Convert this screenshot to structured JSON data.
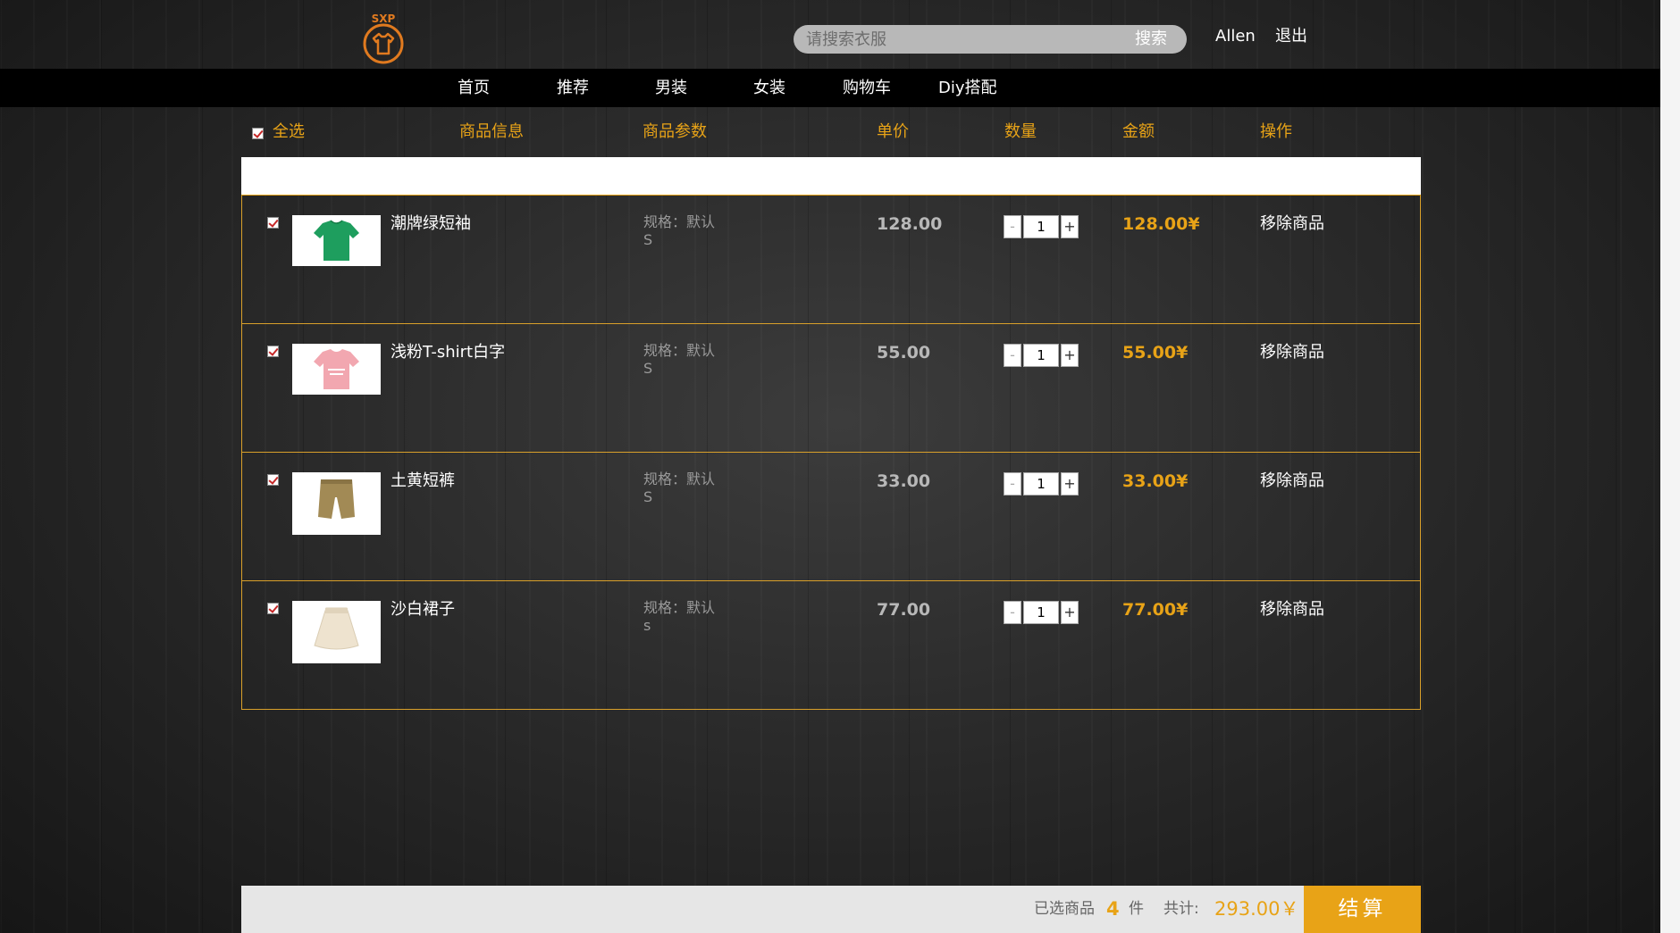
{
  "colors": {
    "accent": "#e8a317",
    "navbar": "#000000",
    "logo": "#e07a1f"
  },
  "header": {
    "logo_text": "SXP",
    "search": {
      "placeholder": "请搜索衣服",
      "button_label": "搜索"
    },
    "username": "Allen",
    "logout_label": "退出"
  },
  "nav": {
    "items": [
      "首页",
      "推荐",
      "男装",
      "女装",
      "购物车",
      "Diy搭配"
    ]
  },
  "table_header": {
    "select_all_label": "全选",
    "product_info": "商品信息",
    "product_params": "商品参数",
    "unit_price": "单价",
    "quantity": "数量",
    "amount": "金额",
    "action": "操作"
  },
  "cart": {
    "items": [
      {
        "name": "潮牌绿短袖",
        "spec_label": "规格：默认",
        "spec_value": "S",
        "price": "128.00",
        "quantity": "1",
        "amount": "128.00¥",
        "remove_label": "移除商品",
        "checked": true,
        "icon": "green-tshirt-icon",
        "item_color": "#1e9e5e"
      },
      {
        "name": "浅粉T-shirt白字",
        "spec_label": "规格：默认",
        "spec_value": "S",
        "price": "55.00",
        "quantity": "1",
        "amount": "55.00¥",
        "remove_label": "移除商品",
        "checked": true,
        "icon": "pink-tshirt-icon",
        "item_color": "#f2a7b0"
      },
      {
        "name": "土黄短裤",
        "spec_label": "规格：默认",
        "spec_value": "S",
        "price": "33.00",
        "quantity": "1",
        "amount": "33.00¥",
        "remove_label": "移除商品",
        "checked": true,
        "icon": "khaki-shorts-icon",
        "item_color": "#a28a55"
      },
      {
        "name": "沙白裙子",
        "spec_label": "规格：默认",
        "spec_value": "s",
        "price": "77.00",
        "quantity": "1",
        "amount": "77.00¥",
        "remove_label": "移除商品",
        "checked": true,
        "icon": "cream-skirt-icon",
        "item_color": "#eee3cf"
      }
    ],
    "qty_minus": "-",
    "qty_plus": "+"
  },
  "footer": {
    "selected_label": "已选商品",
    "selected_count": "4",
    "selected_unit": "件",
    "total_label": "共计:",
    "total_value": "293.00￥",
    "checkout_label": "结算"
  }
}
